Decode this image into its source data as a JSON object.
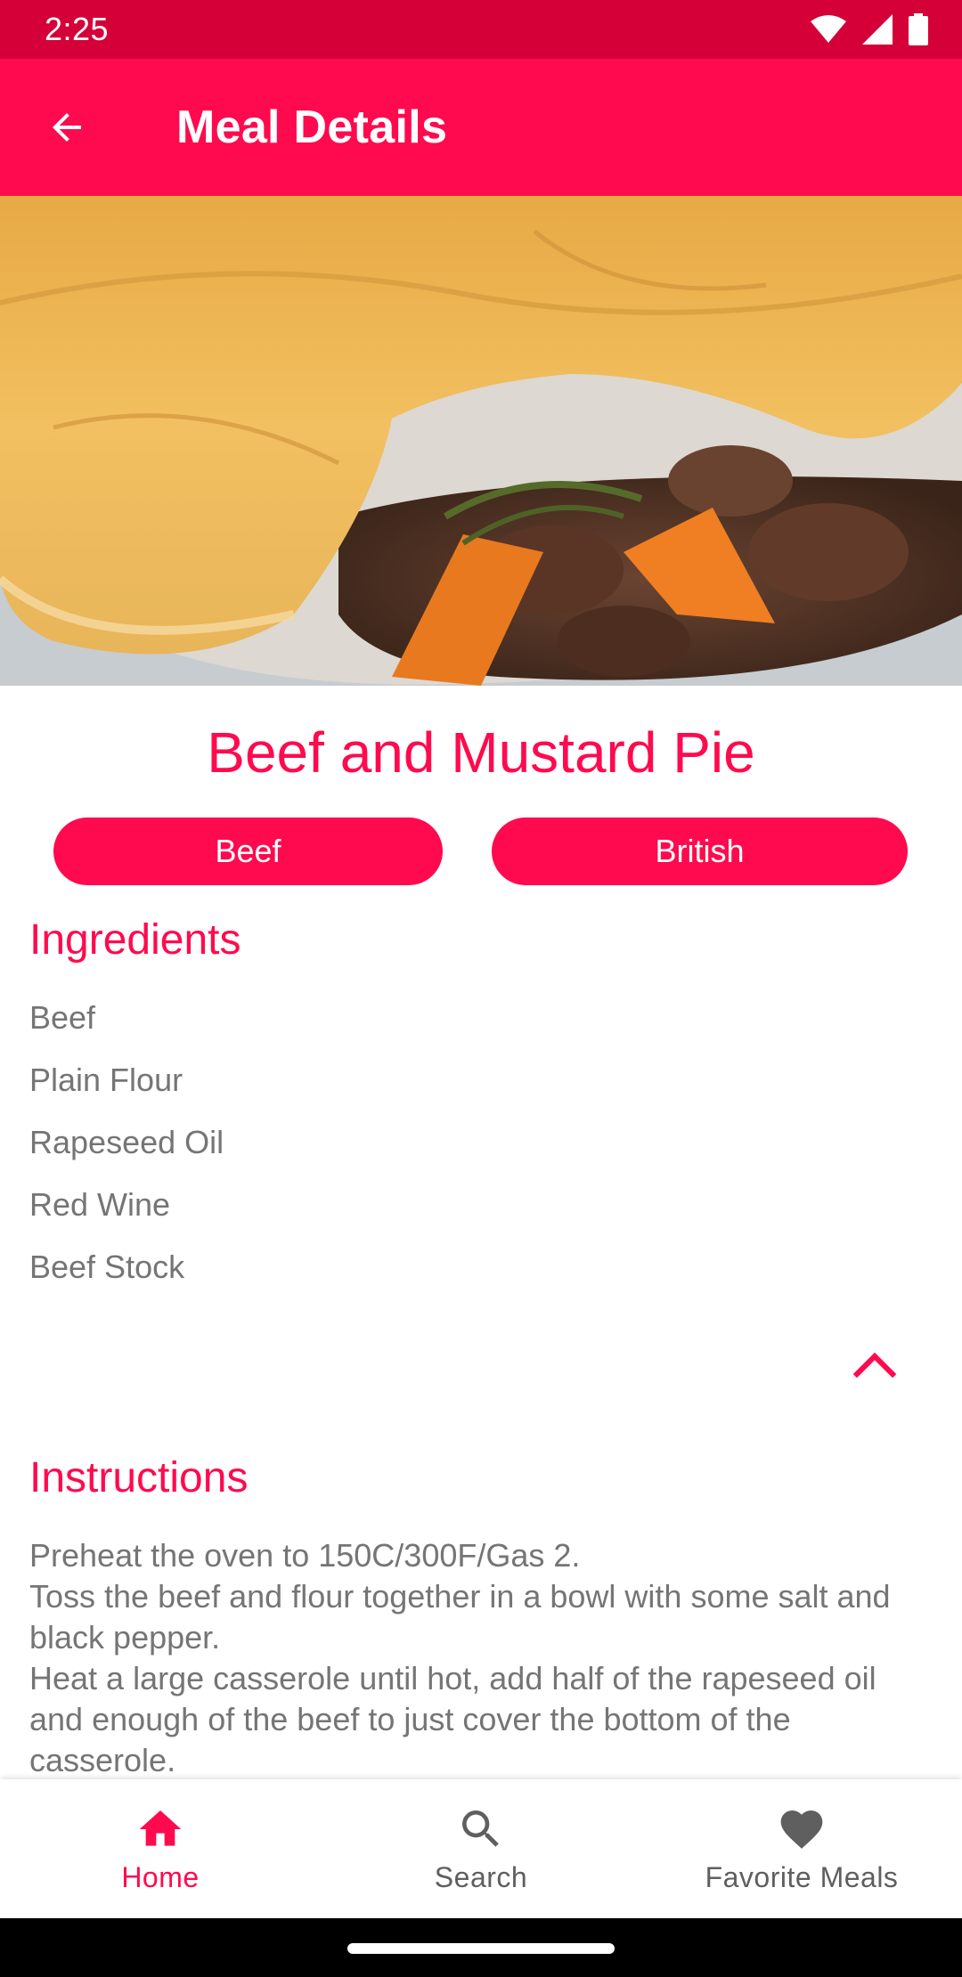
{
  "status_bar": {
    "time": "2:25",
    "icons": [
      "wifi-icon",
      "signal-icon",
      "battery-icon"
    ]
  },
  "app_bar": {
    "title": "Meal Details",
    "back_icon": "arrow-back-icon"
  },
  "meal": {
    "name": "Beef and Mustard Pie",
    "category": "Beef",
    "area": "British"
  },
  "ingredients": {
    "title": "Ingredients",
    "items": [
      "Beef",
      "Plain Flour",
      "Rapeseed Oil",
      "Red Wine",
      "Beef Stock"
    ],
    "toggle_icon": "chevron-up-icon"
  },
  "instructions": {
    "title": "Instructions",
    "text": "Preheat the oven to 150C/300F/Gas 2.\nToss the beef and flour together in a bowl with some salt and black pepper.\nHeat a large casserole until hot, add half of the rapeseed oil and enough of the beef to just cover the bottom of the casserole."
  },
  "bottom_nav": {
    "items": [
      {
        "label": "Home",
        "icon": "home-icon",
        "active": true
      },
      {
        "label": "Search",
        "icon": "search-icon",
        "active": false
      },
      {
        "label": "Favorite Meals",
        "icon": "heart-icon",
        "active": false
      }
    ]
  },
  "colors": {
    "accent": "#ff0a4e",
    "status_bar": "#d50038",
    "secondary_text": "#757575"
  }
}
